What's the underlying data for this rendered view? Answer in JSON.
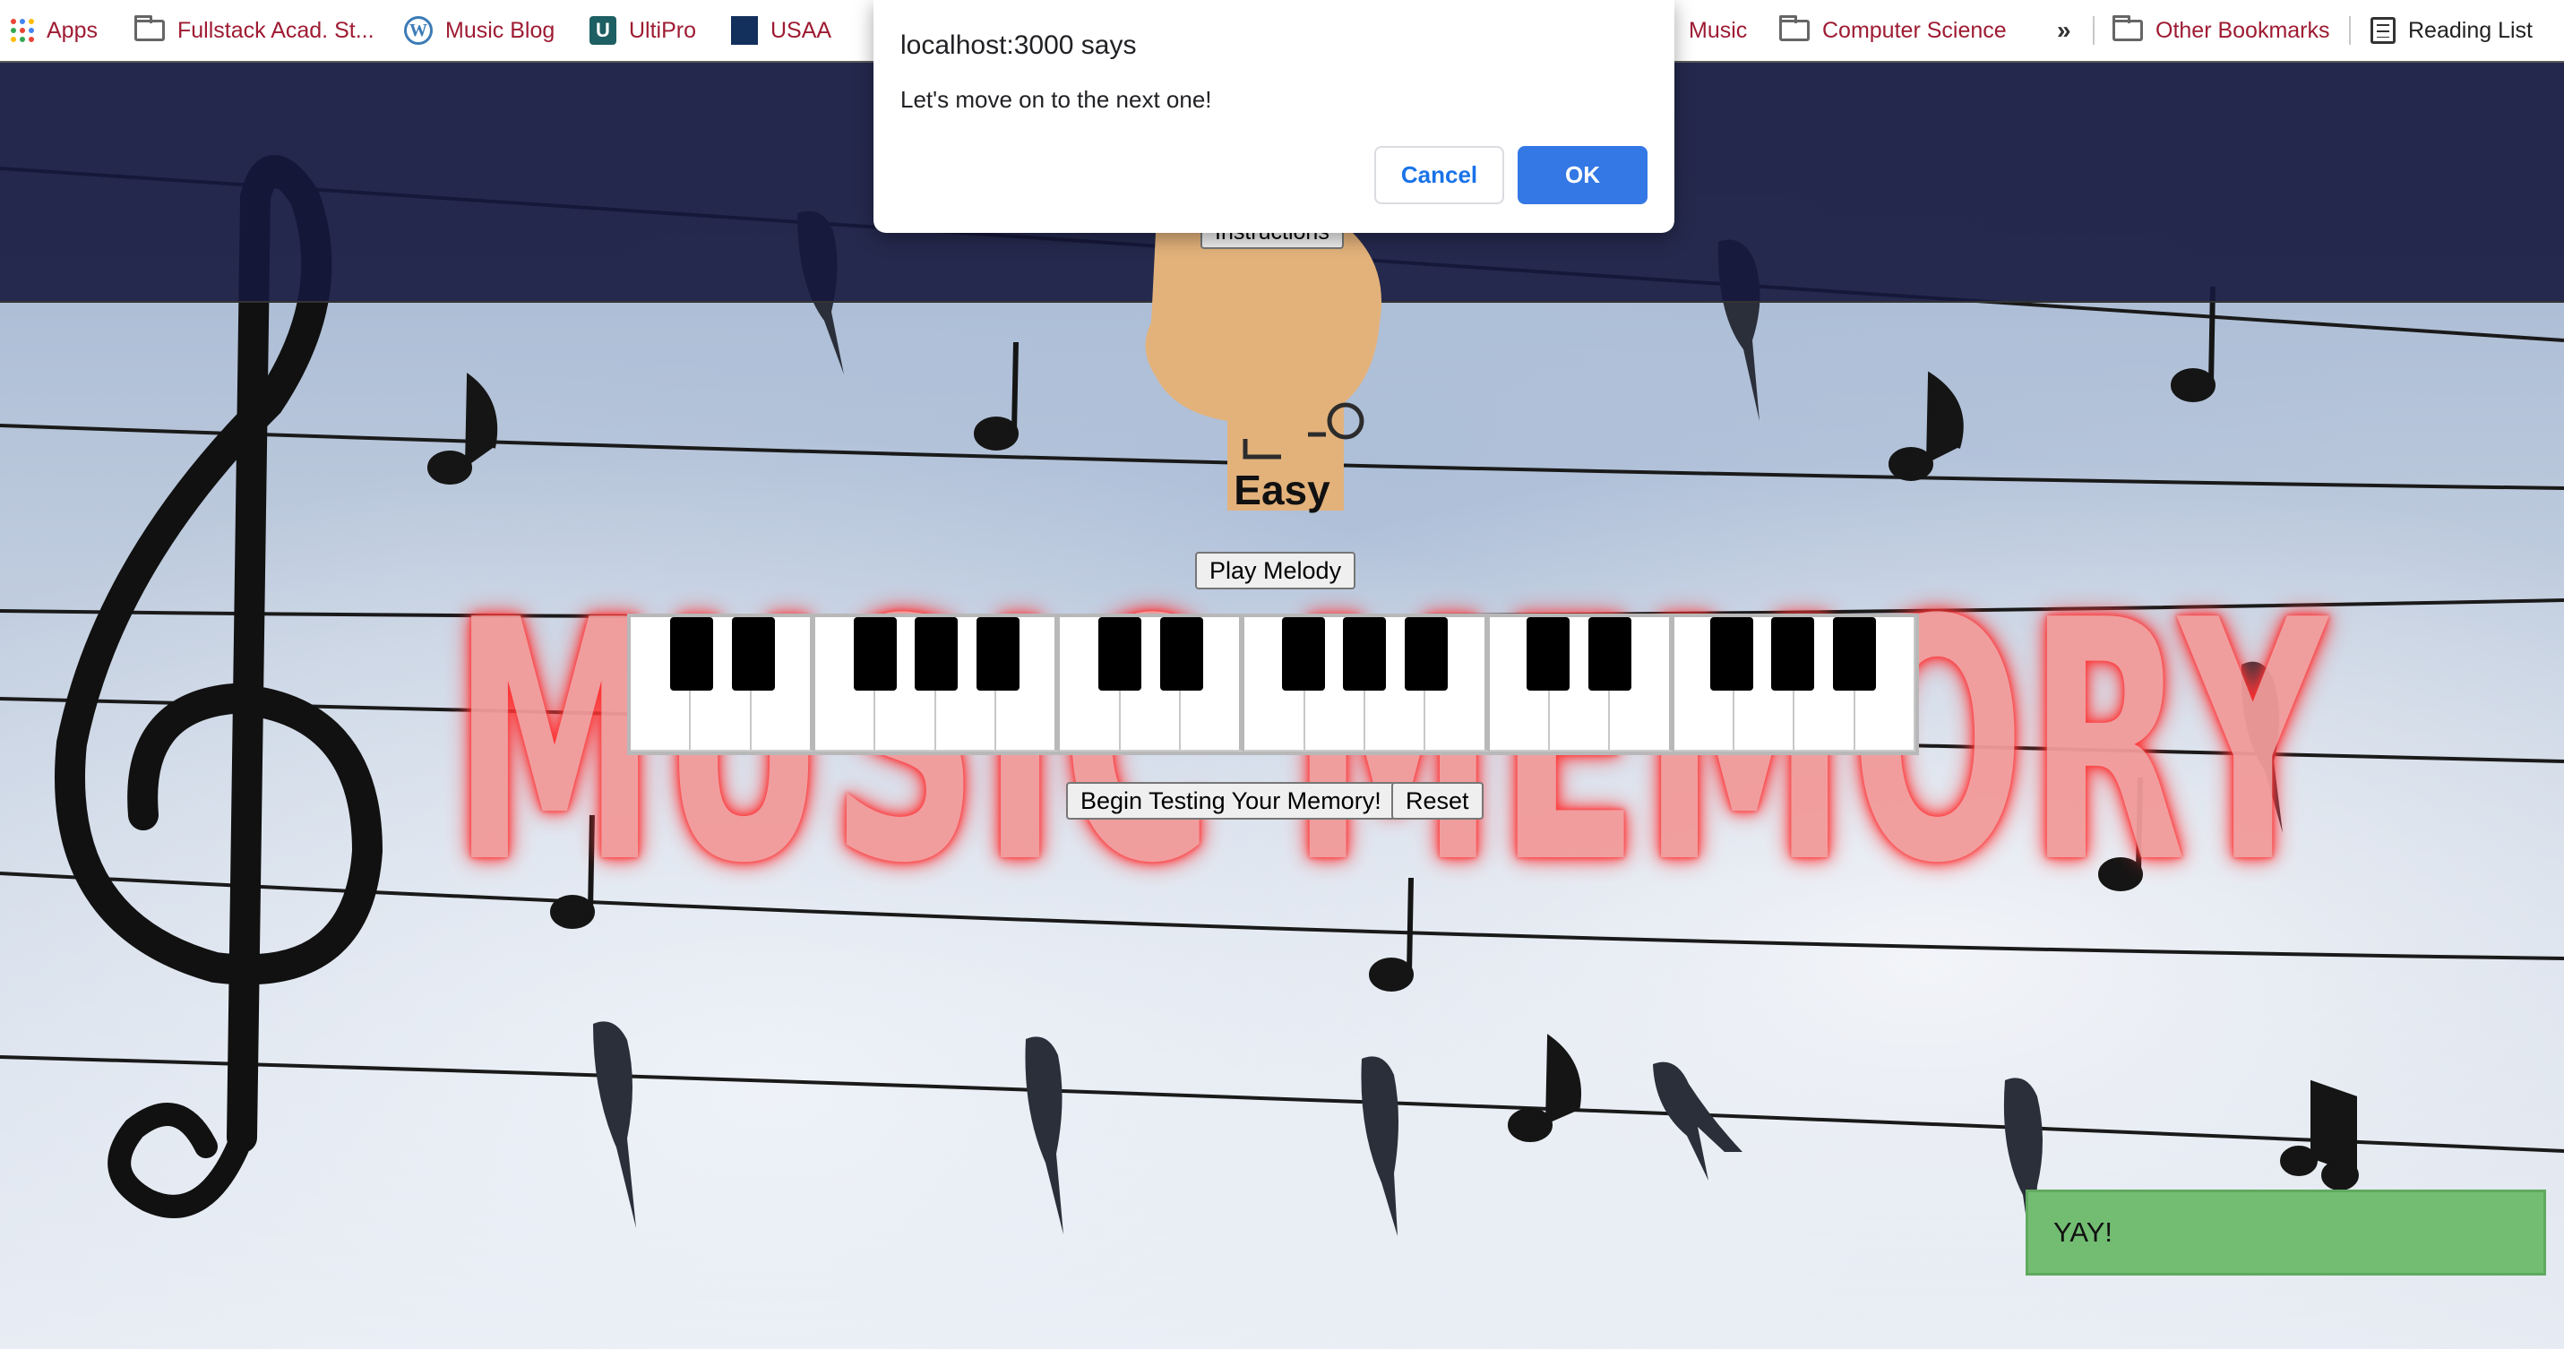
{
  "bookmarks": {
    "items": [
      {
        "label": "Apps",
        "icon": "apps-grid-icon"
      },
      {
        "label": "Fullstack Acad. St...",
        "icon": "folder-icon"
      },
      {
        "label": "Music Blog",
        "icon": "wordpress-icon"
      },
      {
        "label": "UltiPro",
        "icon": "ultipro-icon"
      },
      {
        "label": "USAA",
        "icon": "usaa-icon"
      },
      {
        "label": "Music",
        "icon": "none"
      },
      {
        "label": "Computer Science",
        "icon": "folder-icon"
      }
    ],
    "more": "»",
    "other": "Other Bookmarks",
    "reading_list": "Reading List"
  },
  "page": {
    "nav_button": "Instructions",
    "level": "Easy",
    "play_button": "Play Melody",
    "title_art": "MUSIC MEMORY",
    "begin_button": "Begin Testing Your Memory!",
    "reset_button": "Reset",
    "toast": "YAY!",
    "colors": {
      "toast": "#72bd72",
      "title": "#f29a9a",
      "nav": "#16183e"
    }
  },
  "piano": {
    "white_keys": 21,
    "black_keys": 15
  },
  "dialog": {
    "title": "localhost:3000 says",
    "message": "Let's move on to the next one!",
    "cancel": "Cancel",
    "ok": "OK",
    "accent": "#3478e5"
  }
}
